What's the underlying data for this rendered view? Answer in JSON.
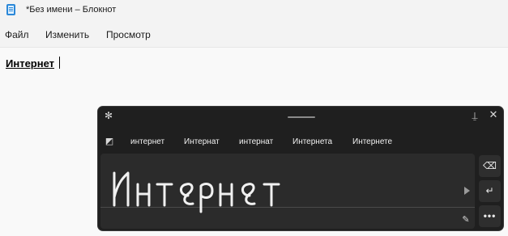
{
  "window": {
    "title": "*Без имени – Блокнот",
    "app_icon": "notepad-icon"
  },
  "menu": {
    "items": [
      "Файл",
      "Изменить",
      "Просмотр"
    ]
  },
  "editor": {
    "text": "Интернет"
  },
  "handwriting_panel": {
    "settings_icon": "gear-icon",
    "dock_icon": "dock-icon",
    "close_icon": "close-icon",
    "clipboard_icon": "clipboard-icon",
    "suggestions": [
      "интернет",
      "Интернат",
      "интернат",
      "Интернета",
      "Интернете"
    ],
    "ink_text": "Интернет",
    "play_icon": "play-icon",
    "pen_icon": "pen-icon",
    "buttons": [
      "⌫",
      "↵",
      "•••"
    ]
  }
}
